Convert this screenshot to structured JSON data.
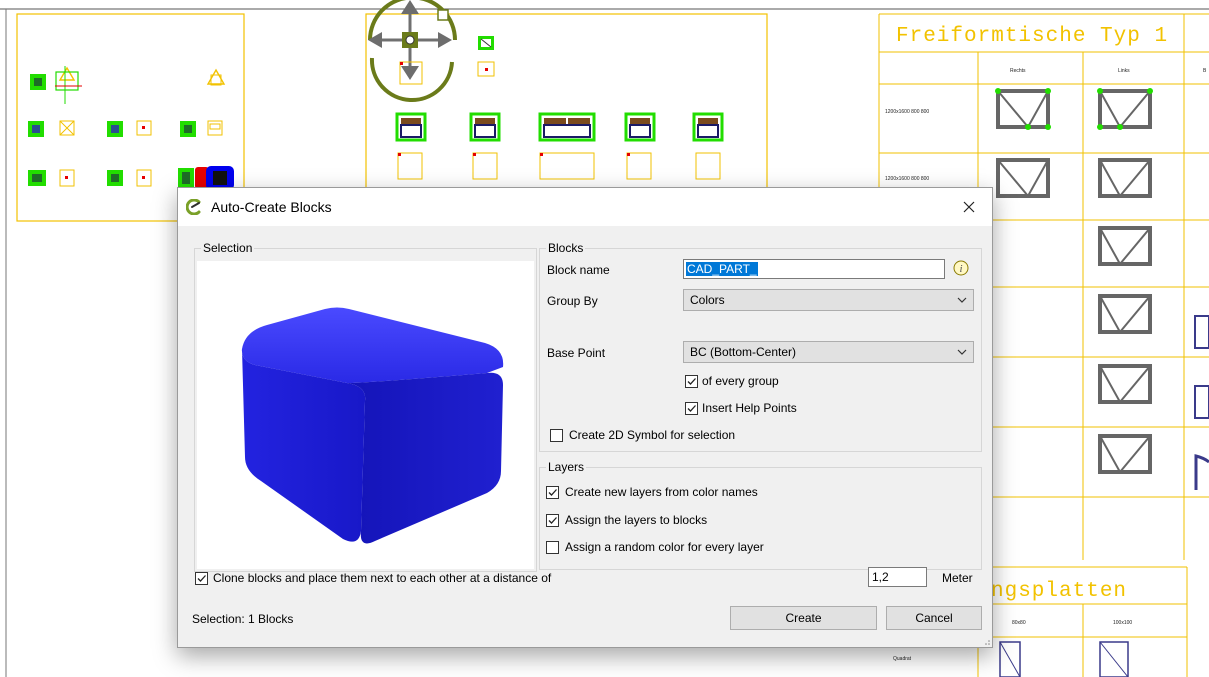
{
  "dialog": {
    "title": "Auto-Create Blocks",
    "close_icon": "close-icon"
  },
  "selection_group": {
    "label": "Selection"
  },
  "blocks_group": {
    "label": "Blocks",
    "block_name_label": "Block name",
    "block_name_value": "CAD_PART_",
    "group_by_label": "Group By",
    "group_by_value": "Colors",
    "base_point_label": "Base Point",
    "base_point_value": "BC (Bottom-Center)",
    "of_every_group": {
      "label": "of every group",
      "checked": true
    },
    "insert_help_points": {
      "label": "Insert Help Points",
      "checked": true
    },
    "create_2d_symbol": {
      "label": "Create 2D Symbol for selection",
      "checked": false
    }
  },
  "layers_group": {
    "label": "Layers",
    "create_layers": {
      "label": "Create new layers from color names",
      "checked": true
    },
    "assign_layers": {
      "label": "Assign the layers to blocks",
      "checked": true
    },
    "random_color": {
      "label": "Assign a random color for every layer",
      "checked": false
    }
  },
  "clone": {
    "label": "Clone blocks and place them next to each other at a distance of",
    "checked": true,
    "distance": "1,2",
    "unit": "Meter"
  },
  "status": {
    "selection_text": "Selection: 1 Blocks"
  },
  "buttons": {
    "create": "Create",
    "cancel": "Cancel"
  },
  "cad": {
    "table1_title": "Freiformtische Typ 1",
    "col_rechts": "Rechts",
    "col_links": "Links",
    "col_b": "B",
    "row1_size": "1200x1600 800 800",
    "row2_size": "1200x1600 800 800",
    "table2_title": "ngsplatten",
    "col_8080": "80x80",
    "col_100100": "100x100",
    "row_quadrat": "Quadrat"
  },
  "colors": {
    "cad_frame": "#f2c200",
    "green_block": "#22dd00",
    "preview_blue": "#1a1adb",
    "selection_blue": "#0078d7"
  }
}
